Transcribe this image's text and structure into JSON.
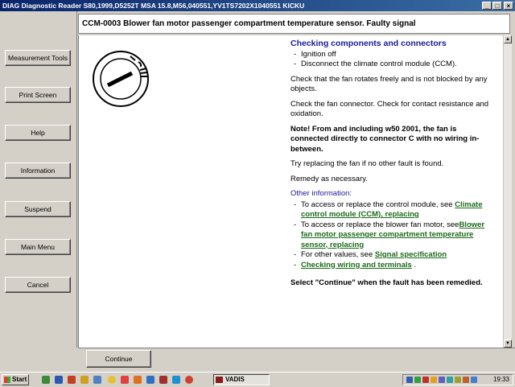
{
  "window": {
    "title": "DIAG Diagnostic Reader S80,1999,D5252T MSA 15.8,M56,040551,YV1TS7202X1040551 KICKU",
    "btn_min": "_",
    "btn_max": "□",
    "btn_close": "×"
  },
  "sidebar": {
    "buttons": [
      {
        "label": "Measurement Tools"
      },
      {
        "label": "Print Screen"
      },
      {
        "label": "Help"
      },
      {
        "label": "Information"
      },
      {
        "label": "Suspend"
      },
      {
        "label": "Main Menu"
      },
      {
        "label": "Cancel"
      }
    ]
  },
  "header": {
    "title": "CCM-0003 Blower fan motor passenger compartment temperature sensor. Faulty signal"
  },
  "content": {
    "section_title": "Checking components and connectors",
    "steps": [
      "Ignition off",
      "Disconnect the climate control module (CCM)."
    ],
    "para1": "Check that the fan rotates freely and is not blocked by any objects.",
    "para2": "Check the fan connector. Check for contact resistance and oxidation.",
    "note": "Note! From and including w50 2001, the fan is connected directly to connector C with no wiring in-between.",
    "para3": "Try replacing the fan if no other fault is found.",
    "para4": "Remedy as necessary.",
    "other_title": "Other information:",
    "other": [
      {
        "prefix": "To access or replace the control module, see ",
        "link": "Climate control module (CCM), replacing",
        "suffix": ""
      },
      {
        "prefix": "To access or replace the blower fan motor, see",
        "link": "Blower fan motor passenger compartment temperature sensor, replacing",
        "suffix": ""
      },
      {
        "prefix": "For other values, see ",
        "link": "Signal specification",
        "suffix": ""
      },
      {
        "prefix": "",
        "link": "Checking wiring and terminals",
        "suffix": " ."
      }
    ],
    "continue_note": "Select \"Continue\" when the fault has been remedied."
  },
  "footer": {
    "continue_label": "Continue"
  },
  "taskbar": {
    "start_label": "Start",
    "task_label": "VADIS",
    "clock": "19:33"
  },
  "colors": {
    "titlebar": "#0a246a",
    "heading_blue": "#1a1a9a",
    "link_green": "#1a6a1a",
    "window_gray": "#d4d0c8"
  }
}
